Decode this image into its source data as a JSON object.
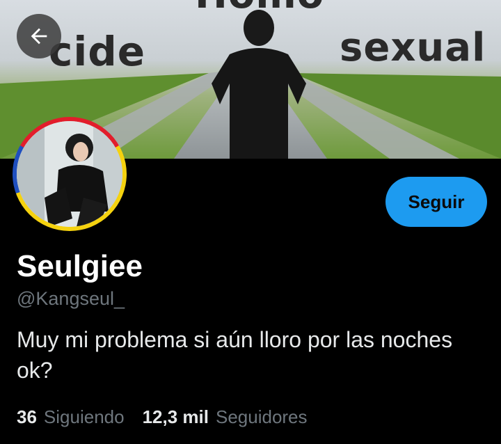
{
  "banner": {
    "top_text": "Homo",
    "left_text": "cide",
    "right_text": "sexual"
  },
  "header": {
    "back_icon": "arrow-left-icon"
  },
  "profile": {
    "follow_label": "Seguir",
    "name": "Seulgiee",
    "handle": "@Kangseul_",
    "bio": "Muy mi problema si aún lloro por las noches ok?",
    "following_count": "36",
    "following_label": "Siguiendo",
    "followers_count": "12,3 mil",
    "followers_label": "Seguidores"
  },
  "colors": {
    "accent": "#1d9bf0",
    "background": "#000000",
    "muted_text": "#6e767d"
  }
}
